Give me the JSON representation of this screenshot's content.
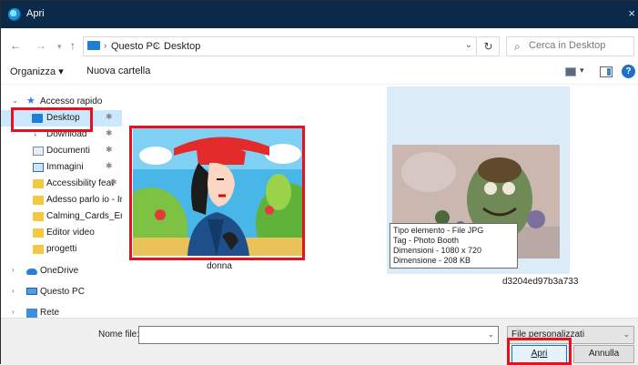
{
  "window": {
    "title": "Apri",
    "close": "×"
  },
  "nav": {
    "back": "←",
    "forward": "→",
    "recent": "▾",
    "up": "↑"
  },
  "address": {
    "crumbs": [
      "Questo PC",
      "Desktop"
    ],
    "separator": "›",
    "dropdown": "⌄"
  },
  "refresh": "↻",
  "search": {
    "icon": "⌕",
    "placeholder": "Cerca in Desktop"
  },
  "toolbar": {
    "organize": "Organizza ▾",
    "new_folder": "Nuova cartella",
    "view_dd": "▾",
    "help": "?"
  },
  "sidebar": {
    "items": [
      {
        "label": "Accesso rapido",
        "icon": "star-icon"
      },
      {
        "label": "Desktop",
        "icon": "desktop-icon",
        "pinned": true
      },
      {
        "label": "Download",
        "icon": "download-icon",
        "pinned": true
      },
      {
        "label": "Documenti",
        "icon": "document-icon",
        "pinned": true
      },
      {
        "label": "Immagini",
        "icon": "image-icon",
        "pinned": true
      },
      {
        "label": "Accessibility feat",
        "icon": "folder-icon",
        "pinned": true
      },
      {
        "label": "Adesso parlo io - In",
        "icon": "folder-icon"
      },
      {
        "label": "Calming_Cards_Eng",
        "icon": "folder-icon"
      },
      {
        "label": "Editor video",
        "icon": "folder-icon"
      },
      {
        "label": "progetti",
        "icon": "folder-icon"
      },
      {
        "label": "OneDrive",
        "icon": "cloud-icon"
      },
      {
        "label": "Questo PC",
        "icon": "pc-icon"
      },
      {
        "label": "Rete",
        "icon": "network-icon"
      }
    ],
    "pin": "✱",
    "expanded": "⌄",
    "collapsed": "›"
  },
  "files": [
    {
      "name": "donna"
    },
    {
      "name": "d3204ed97b3a733"
    }
  ],
  "tooltip": [
    "Tipo elemento - File JPG",
    "Tag - Photo Booth",
    "Dimensioni - 1080 x 720",
    "Dimensione - 208 KB"
  ],
  "footer": {
    "filename_label": "Nome file:",
    "filename_value": "",
    "filename_dd": "⌄",
    "filetype": "File personalizzati",
    "filetype_dd": "⌄",
    "open": "Apri",
    "cancel": "Annulla"
  },
  "colors": {
    "titlebar": "#0b2a4a",
    "highlight": "#e6111c",
    "selection": "#cce8ff"
  }
}
